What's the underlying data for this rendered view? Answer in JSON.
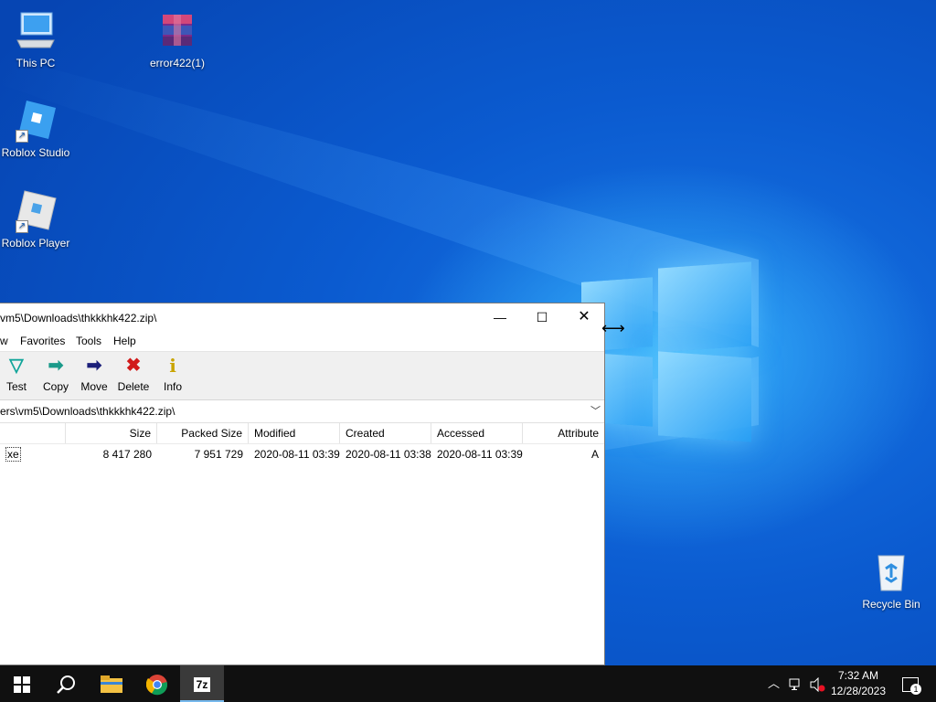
{
  "desktop": {
    "icons": [
      {
        "label": "This PC",
        "icon": "computer-icon"
      },
      {
        "label": "error422(1)",
        "icon": "winrar-archive-icon"
      },
      {
        "label": "Roblox Studio",
        "icon": "roblox-studio-icon"
      },
      {
        "label": "Roblox Player",
        "icon": "roblox-player-icon"
      },
      {
        "label": "Recycle Bin",
        "icon": "recycle-bin-icon"
      }
    ]
  },
  "window": {
    "title": "vm5\\Downloads\\thkkkhk422.zip\\",
    "menu": [
      "w",
      "Favorites",
      "Tools",
      "Help"
    ],
    "toolbar": [
      {
        "label": "Test",
        "icon": "test-icon"
      },
      {
        "label": "Copy",
        "icon": "copy-icon"
      },
      {
        "label": "Move",
        "icon": "move-icon"
      },
      {
        "label": "Delete",
        "icon": "delete-icon"
      },
      {
        "label": "Info",
        "icon": "info-icon"
      }
    ],
    "address": "ers\\vm5\\Downloads\\thkkkhk422.zip\\",
    "columns": [
      "Size",
      "Packed Size",
      "Modified",
      "Created",
      "Accessed",
      "Attribute"
    ],
    "rows": [
      {
        "name": "xe",
        "size": "8 417 280",
        "packed": "7 951 729",
        "modified": "2020-08-11 03:39",
        "created": "2020-08-11 03:38",
        "accessed": "2020-08-11 03:39",
        "attr": "A"
      }
    ]
  },
  "taskbar": {
    "apps": [
      "start-icon",
      "search-icon",
      "file-explorer-icon",
      "chrome-icon",
      "7zip-icon"
    ],
    "active_app_label": "7z",
    "time": "7:32 AM",
    "date": "12/28/2023",
    "notification_count": "1"
  },
  "colors": {
    "accent": "#76b9ed",
    "taskbar": "#101010",
    "delete_red": "#d11a1a"
  }
}
